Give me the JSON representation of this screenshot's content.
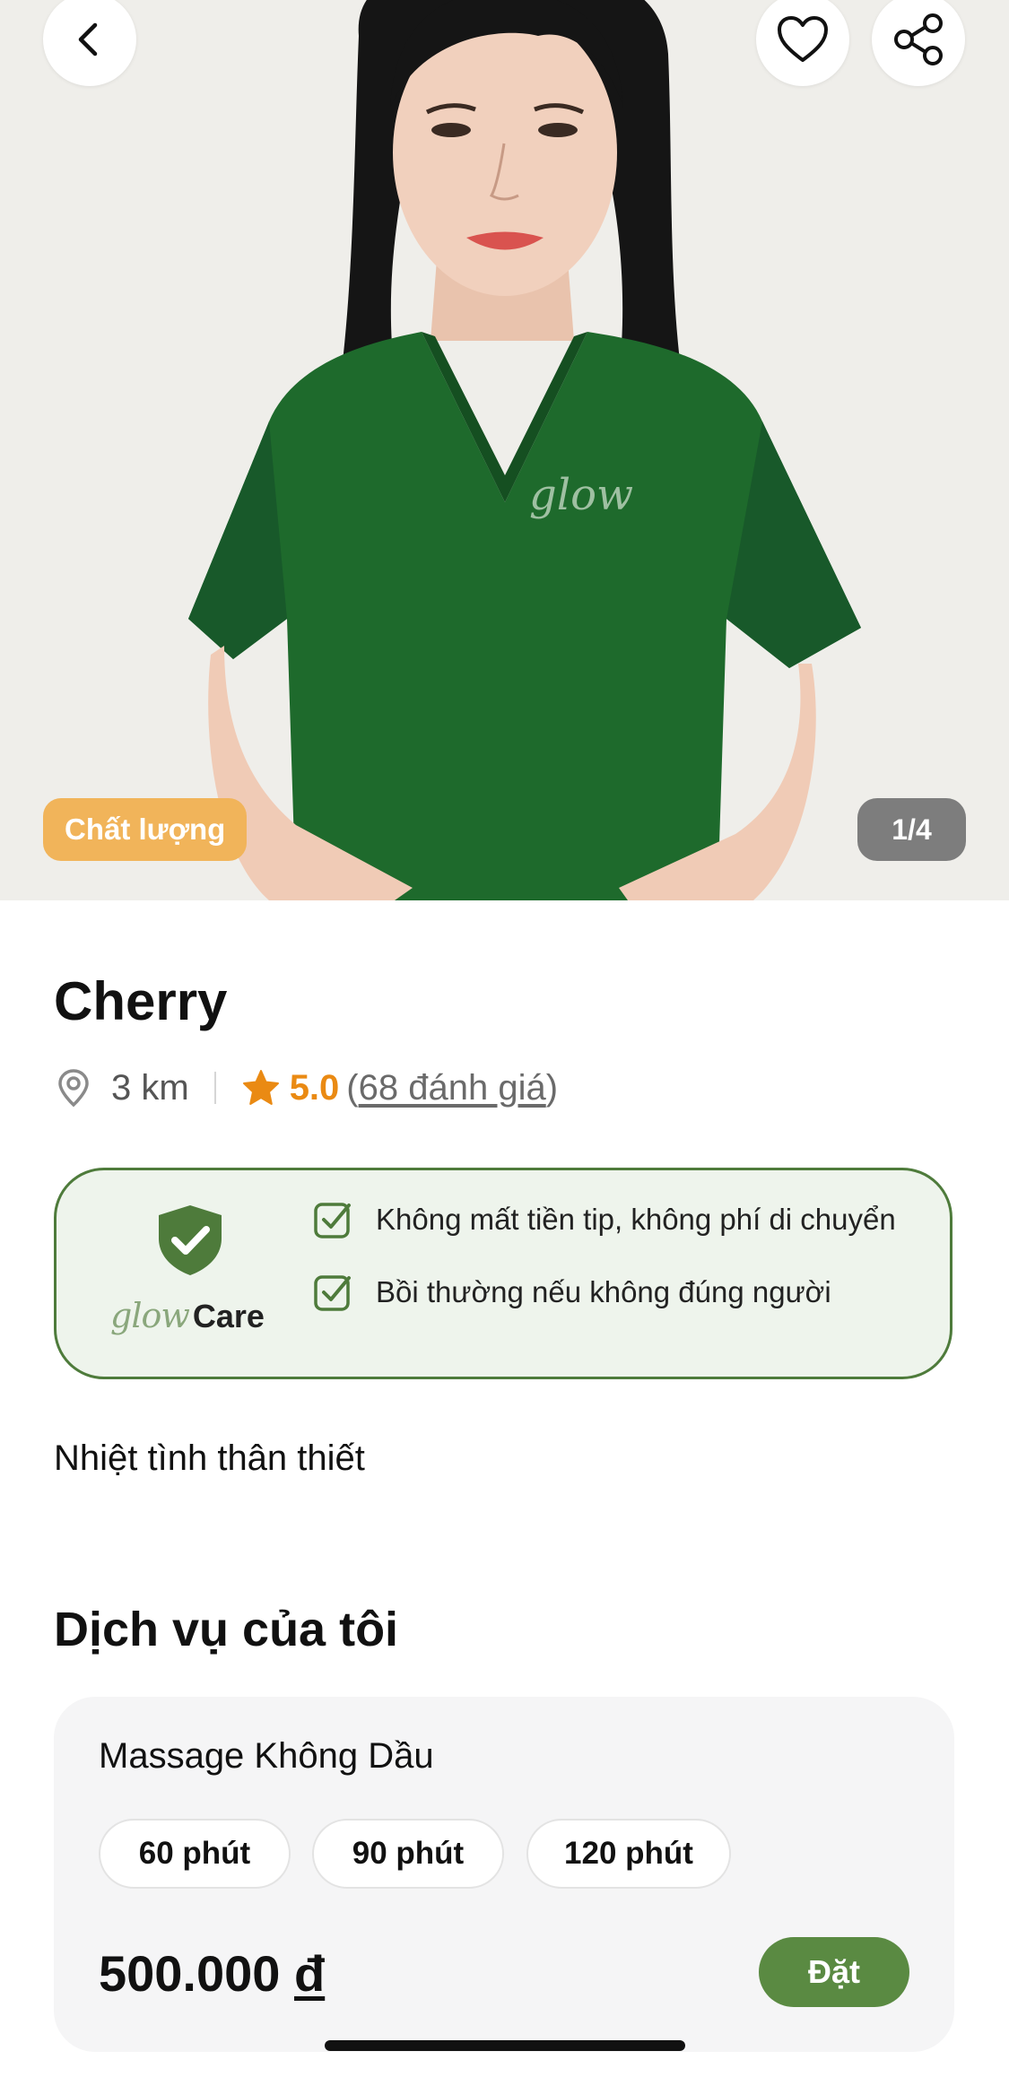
{
  "hero": {
    "badge_label": "Chất lượng",
    "image_counter": "1/4",
    "shirt_logo": "glow",
    "icons": [
      "chevron-left-icon",
      "heart-icon",
      "share-icon"
    ]
  },
  "profile": {
    "name": "Cherry",
    "distance": "3 km",
    "rating": "5.0",
    "reviews_open": "(",
    "reviews_link": "68 đánh giá",
    "reviews_close": ")"
  },
  "care": {
    "brand_glow": "glow",
    "brand_care": "Care",
    "items": [
      "Không mất tiền tip, không phí di chuyển",
      "Bồi thường nếu không đúng người"
    ]
  },
  "description": "Nhiệt tình thân thiết",
  "services": {
    "title": "Dịch vụ của tôi",
    "item": {
      "name": "Massage Không Dầu",
      "durations": [
        "60 phút",
        "90 phút",
        "120 phút"
      ],
      "price_amount": "500.000",
      "price_currency": "đ",
      "book_label": "Đặt"
    }
  },
  "colors": {
    "brand_green": "#5a8a42",
    "care_border": "#4e7b3b",
    "care_bg": "#eef4ec",
    "rating_orange": "#ea8a13",
    "badge_orange": "#f1b45a"
  }
}
